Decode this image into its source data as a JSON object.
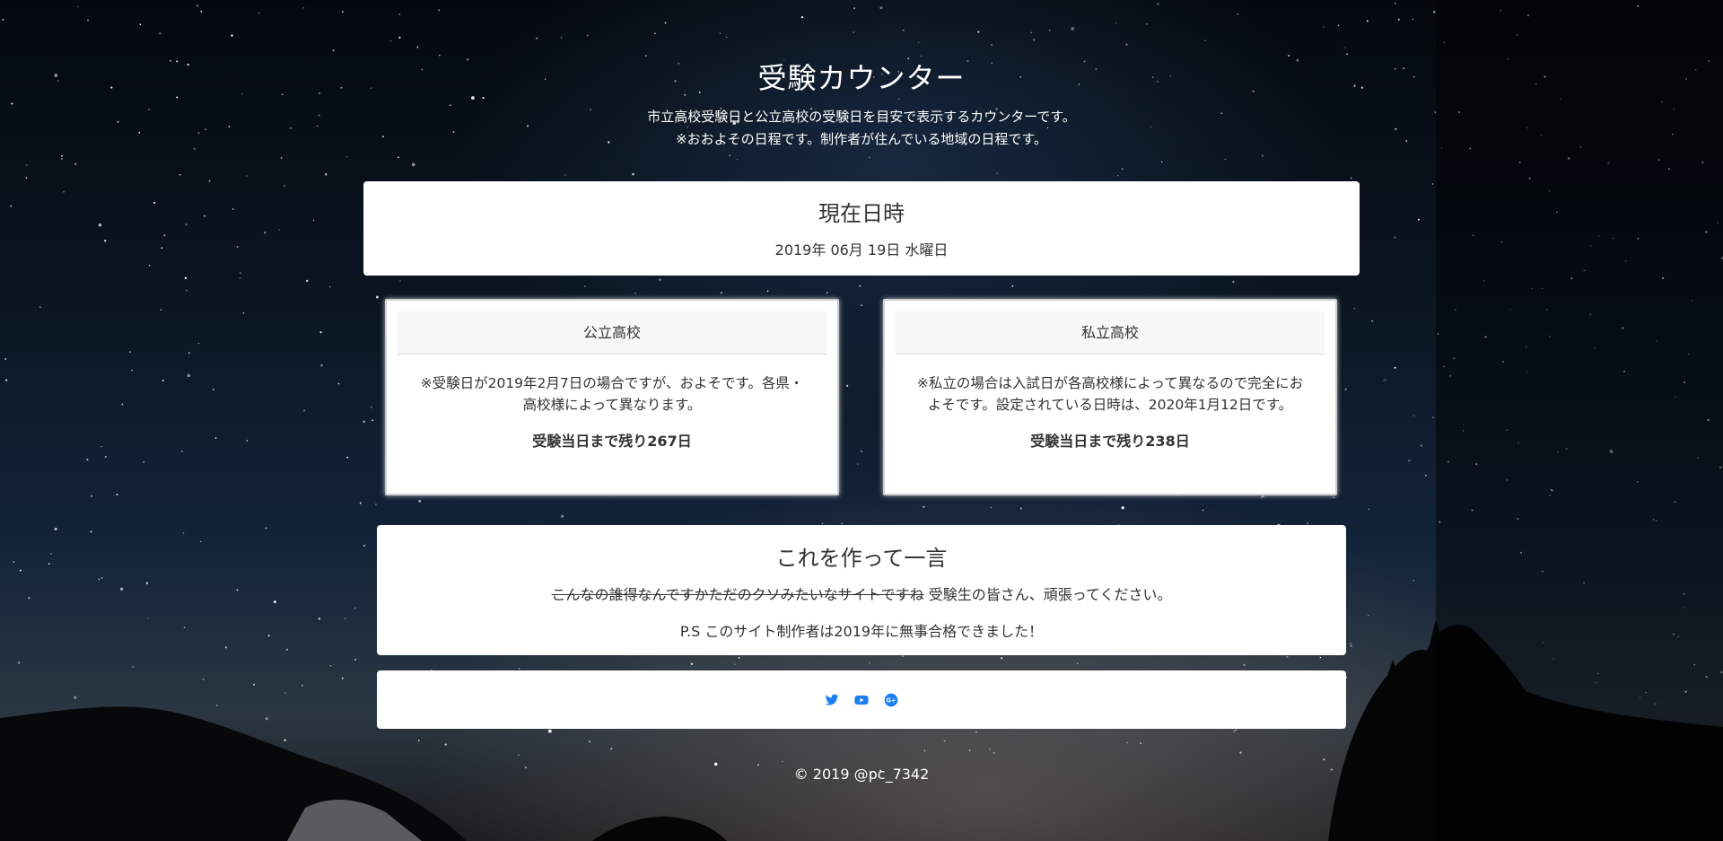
{
  "header": {
    "title": "受験カウンター",
    "subtitle_line1": "市立高校受験日と公立高校の受験日を目安で表示するカウンターです。",
    "subtitle_line2": "※おおよその日程です。制作者が住んでいる地域の日程です。"
  },
  "current": {
    "heading": "現在日時",
    "date": "2019年 06月 19日 水曜日"
  },
  "public_school": {
    "heading": "公立高校",
    "note": "※受験日が2019年2月7日の場合ですが、およそです。各県・高校様によって異なります。",
    "remaining": "受験当日まで残り267日"
  },
  "private_school": {
    "heading": "私立高校",
    "note": "※私立の場合は入試日が各高校様によって異なるので完全におよそです。設定されている日時は、2020年1月12日です。",
    "remaining": "受験当日まで残り238日"
  },
  "message": {
    "heading": "これを作って一言",
    "struck_text": "こんなの誰得なんですかただのクソみたいなサイトですね",
    "text": " 受験生の皆さん、頑張ってください。",
    "ps": "P.S このサイト制作者は2019年に無事合格できました！"
  },
  "social": {
    "icons": [
      "twitter-icon",
      "youtube-icon",
      "google-plus-icon"
    ],
    "color": "#1d7ff2"
  },
  "footer": {
    "copyright": "© 2019 @pc_7342"
  }
}
